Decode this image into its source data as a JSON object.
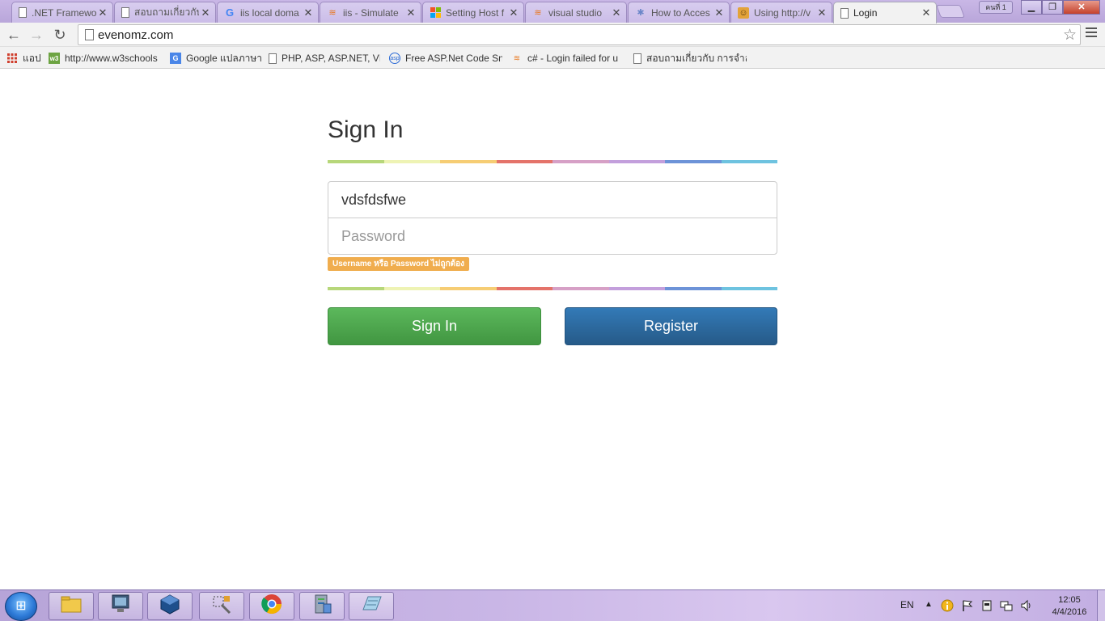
{
  "browser": {
    "tabs": [
      {
        "title": ".NET Framewo",
        "icon": "page-icon"
      },
      {
        "title": "สอบถามเกี่ยวกับ",
        "icon": "page-icon"
      },
      {
        "title": "iis local doma",
        "icon": "google-icon"
      },
      {
        "title": "iis - Simulate",
        "icon": "stackoverflow-icon"
      },
      {
        "title": "Setting Host f",
        "icon": "microsoft-icon"
      },
      {
        "title": "visual studio",
        "icon": "stackoverflow-icon"
      },
      {
        "title": "How to Acces",
        "icon": "msdn-icon"
      },
      {
        "title": "Using http://v",
        "icon": "avatar-icon"
      },
      {
        "title": "Login",
        "icon": "page-icon",
        "active": true
      }
    ],
    "close_glyph": "✕",
    "profile_label": "คนที่ 1",
    "window_controls": {
      "minimize": "▁",
      "maximize": "❐",
      "close": "✕"
    },
    "url": "evenomz.com",
    "bookmarks": [
      {
        "label": "แอป",
        "icon": "apps-icon"
      },
      {
        "label": "http://www.w3schools",
        "icon": "w3schools-icon"
      },
      {
        "label": "Google แปลภาษา",
        "icon": "google-translate-icon"
      },
      {
        "label": "PHP, ASP, ASP.NET, VI",
        "icon": "page-icon"
      },
      {
        "label": "Free ASP.Net Code Sn",
        "icon": "asp-icon"
      },
      {
        "label": "c# - Login failed for u",
        "icon": "stackoverflow-icon"
      },
      {
        "label": "สอบถามเกี่ยวกับ การจำลอ",
        "icon": "page-icon"
      }
    ]
  },
  "login": {
    "title": "Sign In",
    "username_value": "vdsfdsfwe",
    "password_placeholder": "Password",
    "error_message": "Username หรือ Password ไม่ถูกต้อง",
    "signin_label": "Sign In",
    "register_label": "Register",
    "rainbow_colors": [
      "#b7d77a",
      "#eef3b4",
      "#f6cd74",
      "#e4736a",
      "#d6a0c6",
      "#c39fdc",
      "#6d93d8",
      "#6ec3e0"
    ],
    "signin_color": "#5cb85c",
    "register_color": "#337ab7",
    "error_color": "#f0ad4e"
  },
  "taskbar": {
    "apps": [
      "file-explorer-icon",
      "computer-icon",
      "virtualbox-icon",
      "tools-icon",
      "chrome-icon",
      "server-manager-icon",
      "notepad-icon"
    ],
    "language": "EN",
    "time": "12:05",
    "date": "4/4/2016"
  }
}
